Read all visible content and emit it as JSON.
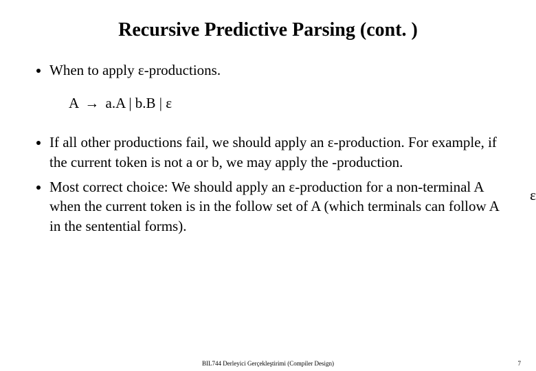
{
  "title": "Recursive Predictive Parsing (cont. )",
  "bullets": {
    "b1": "When to apply ε-productions.",
    "b2": "If all other productions fail, we should apply an ε-production. For example, if the current token is not a or b, we may apply the        -production.",
    "b3": "Most correct choice: We should apply an ε-production for a non-terminal A when the current token is in the follow set of A (which terminals can follow A in the sentential forms)."
  },
  "grammar": {
    "lhs": "A",
    "arrow": "→",
    "rhs": "a.A | b.B | ε"
  },
  "edge_epsilon": "ε",
  "footer": {
    "center": "BIL744 Derleyici Gerçekleştirimi (Compiler Design)",
    "page": "7"
  }
}
